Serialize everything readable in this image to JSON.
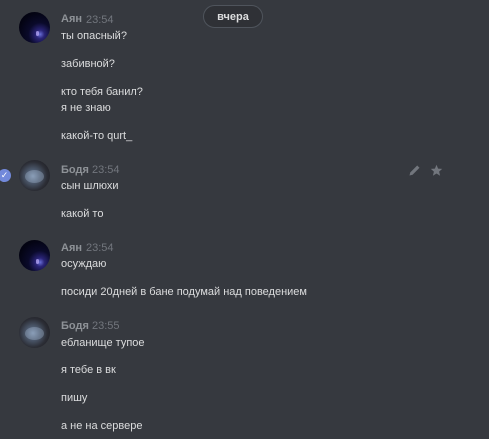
{
  "date_divider": "вчера",
  "groups": [
    {
      "author": "Аян",
      "time": "23:54",
      "avatar": "dark-space-avatar",
      "messages": [
        "ты опасный?",
        "забивной?",
        "кто тебя банил?",
        "я не знаю",
        "какой-то qurt_"
      ]
    },
    {
      "author": "Бодя",
      "time": "23:54",
      "avatar": "blurry-face-avatar",
      "messages": [
        "сын шлюхи",
        "какой то"
      ]
    },
    {
      "author": "Аян",
      "time": "23:54",
      "avatar": "dark-space-avatar",
      "messages": [
        "осуждаю",
        "посиди 20дней в бане подумай над поведением"
      ]
    },
    {
      "author": "Бодя",
      "time": "23:55",
      "avatar": "blurry-face-avatar",
      "messages": [
        "ебланище тупое",
        "я тебе в вк",
        "пишу",
        "а не на сервере"
      ]
    }
  ],
  "hover_actions": [
    "pencil-icon",
    "star-icon"
  ],
  "colors": {
    "background": "#36393f",
    "text": "#dcddde",
    "author": "#8e9297",
    "timestamp": "#72767d",
    "accent": "#7289da"
  }
}
